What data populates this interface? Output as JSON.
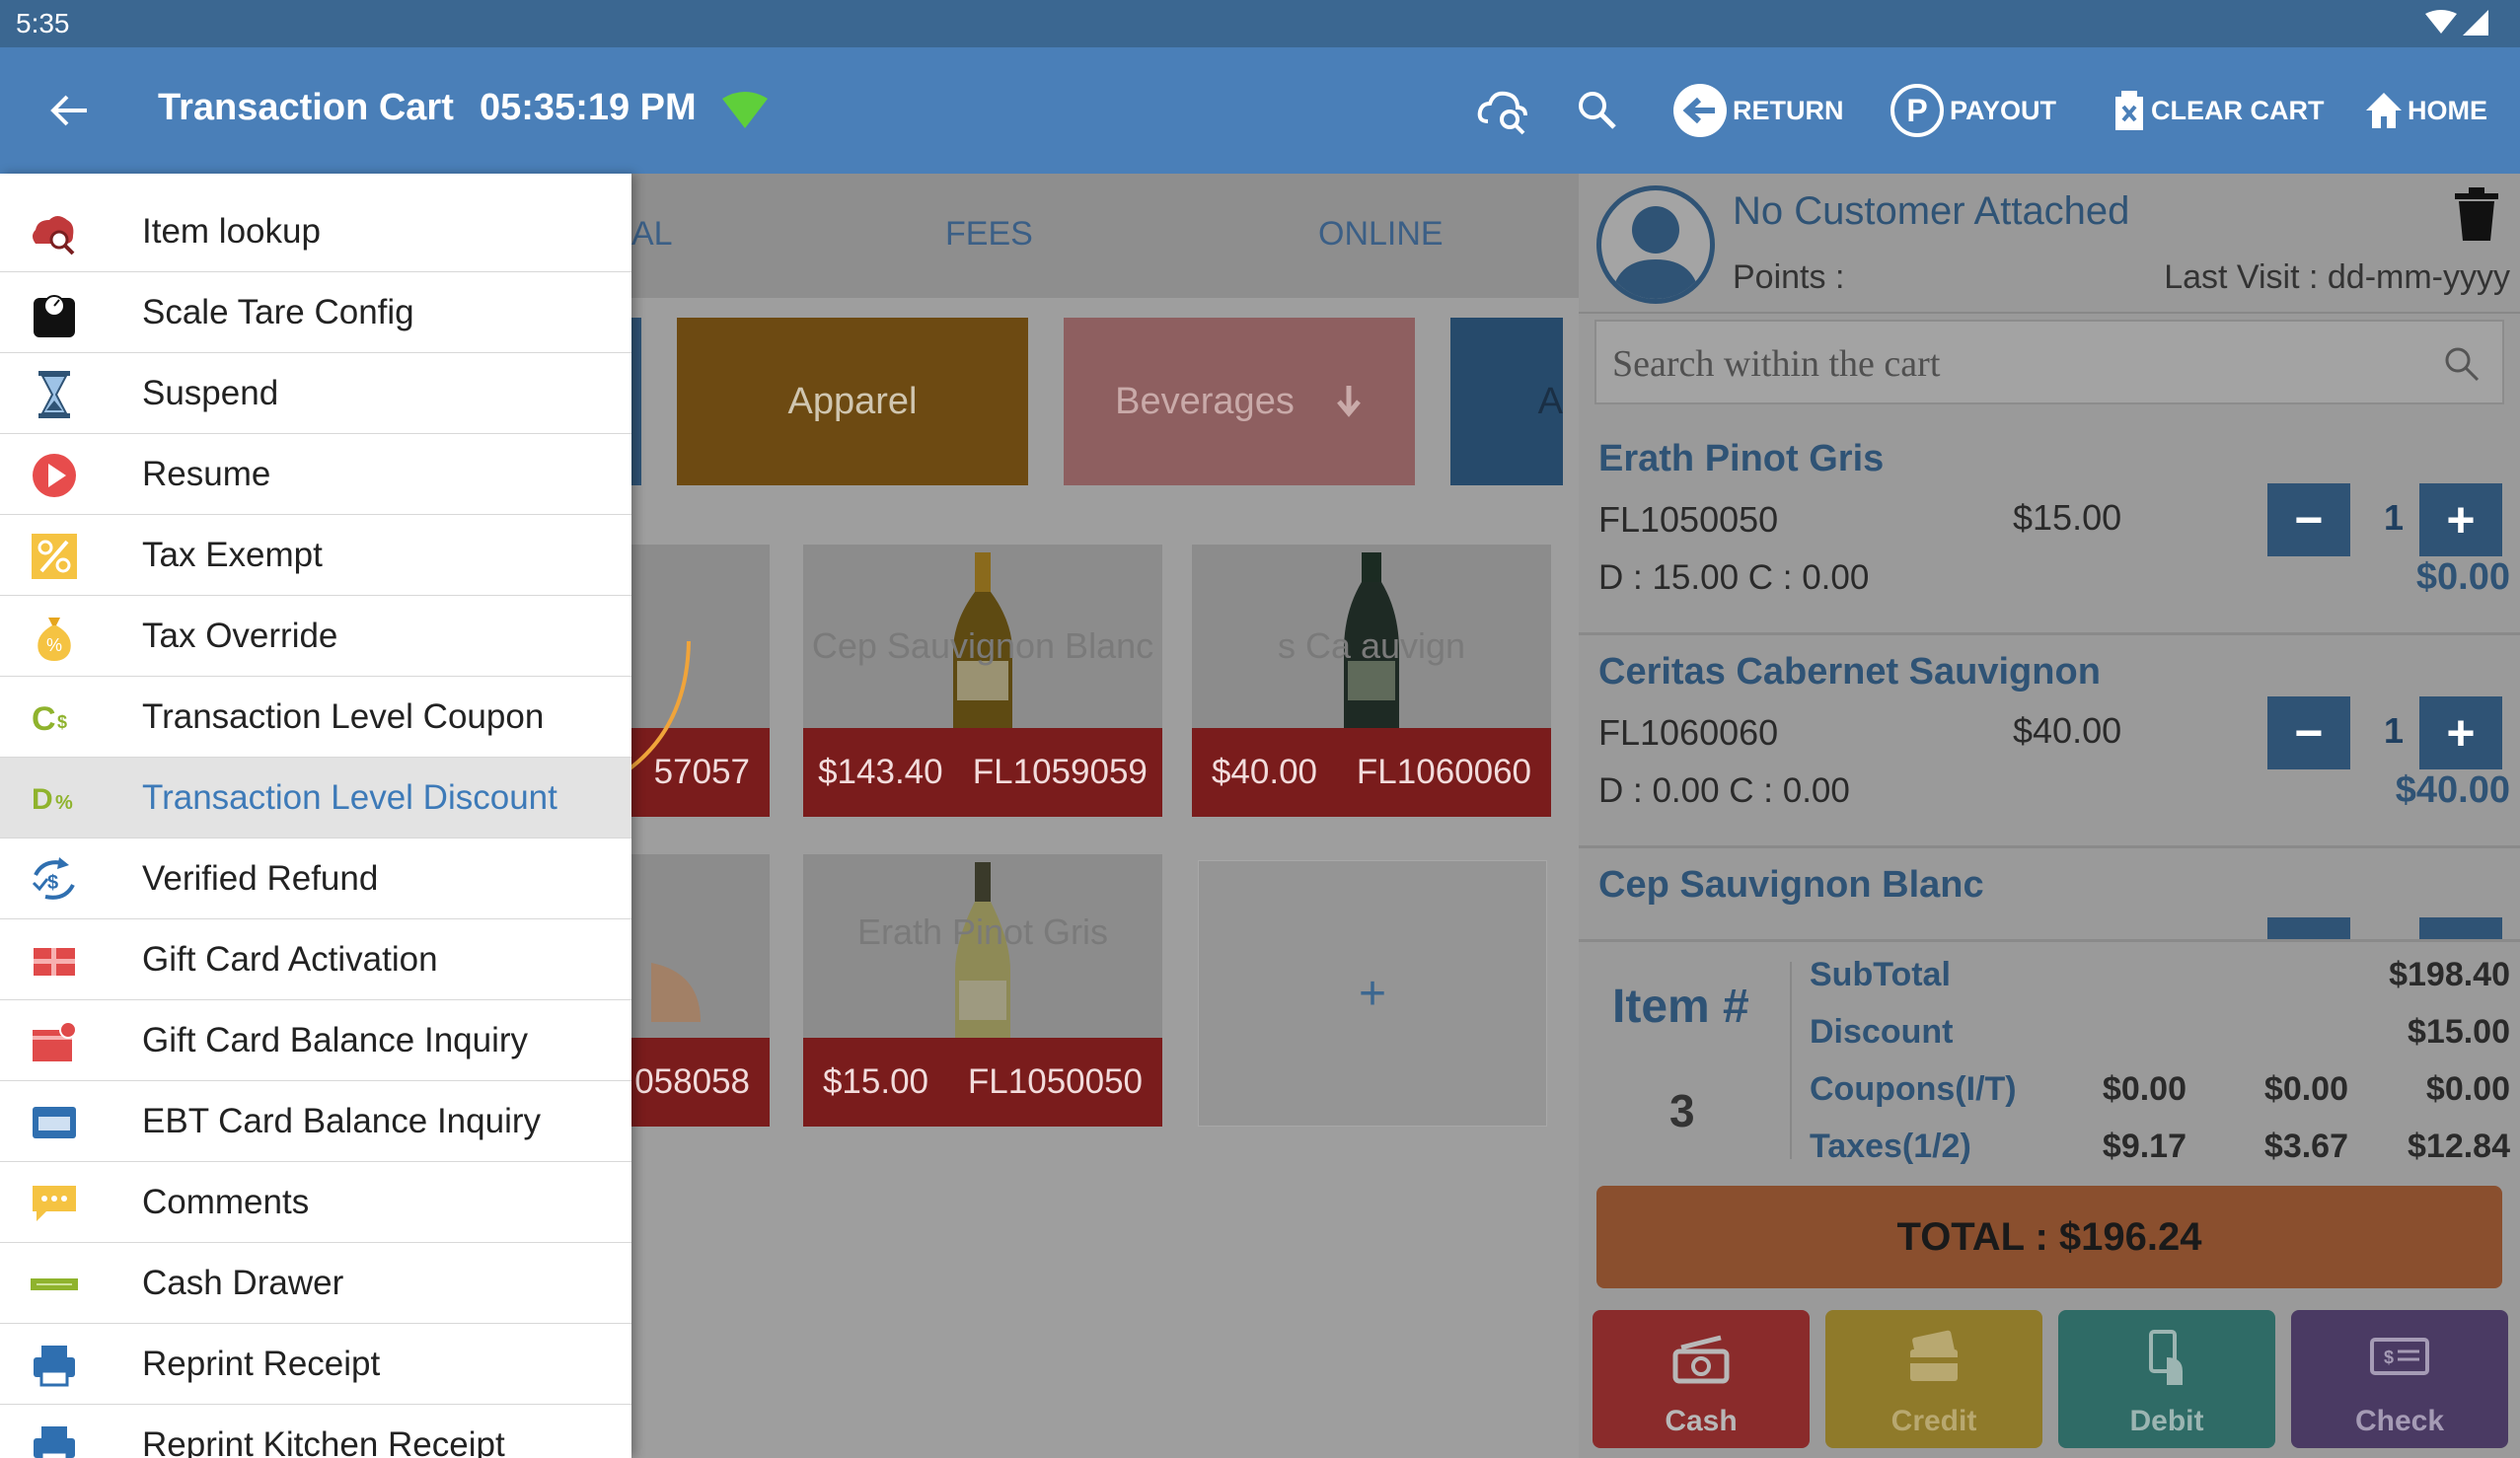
{
  "status": {
    "time": "5:35"
  },
  "appbar": {
    "title": "Transaction Cart",
    "clock": "05:35:19 PM",
    "actions": {
      "return": "RETURN",
      "payout": "PAYOUT",
      "clear_cart": "CLEAR CART",
      "home": "HOME"
    }
  },
  "tabs": [
    "AL",
    "FEES",
    "ONLINE"
  ],
  "categories": [
    "Apparel",
    "Beverages",
    "A"
  ],
  "products": [
    {
      "label": "",
      "price": "",
      "sku": "57057"
    },
    {
      "label": "Cep Sauvignon Blanc",
      "price": "$143.40",
      "sku": "FL1059059"
    },
    {
      "label": "s Ca auvign",
      "price": "$40.00",
      "sku": "FL1060060"
    },
    {
      "label": "",
      "price": "",
      "sku": "058058"
    },
    {
      "label": "Erath Pinot Gris",
      "price": "$15.00",
      "sku": "FL1050050"
    }
  ],
  "add_tile": "+",
  "menu": [
    {
      "label": "Item lookup",
      "icon": "cloud-search-icon"
    },
    {
      "label": "Scale Tare Config",
      "icon": "scale-icon"
    },
    {
      "label": "Suspend",
      "icon": "hourglass-icon"
    },
    {
      "label": "Resume",
      "icon": "play-icon"
    },
    {
      "label": "Tax Exempt",
      "icon": "percent-icon"
    },
    {
      "label": "Tax Override",
      "icon": "money-bag-icon"
    },
    {
      "label": "Transaction Level Coupon",
      "icon": "coupon-icon"
    },
    {
      "label": "Transaction Level Discount",
      "icon": "discount-icon"
    },
    {
      "label": "Verified Refund",
      "icon": "refund-icon"
    },
    {
      "label": "Gift Card Activation",
      "icon": "gift-card-icon"
    },
    {
      "label": "Gift Card Balance Inquiry",
      "icon": "gift-balance-icon"
    },
    {
      "label": "EBT Card Balance Inquiry",
      "icon": "ebt-card-icon"
    },
    {
      "label": "Comments",
      "icon": "comment-icon"
    },
    {
      "label": "Cash Drawer",
      "icon": "cash-drawer-icon"
    },
    {
      "label": "Reprint Receipt",
      "icon": "printer-icon"
    },
    {
      "label": "Reprint Kitchen Receipt",
      "icon": "printer-icon"
    }
  ],
  "customer": {
    "name": "No Customer Attached",
    "points": "Points :",
    "last_visit": "Last Visit : dd-mm-yyyy"
  },
  "cart_search": {
    "placeholder": "Search within the cart"
  },
  "cart_items": [
    {
      "name": "Erath Pinot Gris",
      "sku": "FL1050050",
      "price": "$15.00",
      "dc": "D : 15.00     C : 0.00",
      "qty": "1",
      "total": "$0.00"
    },
    {
      "name": "Ceritas Cabernet Sauvignon",
      "sku": "FL1060060",
      "price": "$40.00",
      "dc": "D : 0.00     C : 0.00",
      "qty": "1",
      "total": "$40.00"
    },
    {
      "name": "Cep Sauvignon Blanc",
      "sku": "",
      "price": "",
      "dc": "",
      "qty": "",
      "total": ""
    }
  ],
  "summary": {
    "item_label": "Item #",
    "item_count": "3",
    "subtotal_label": "SubTotal",
    "subtotal": "$198.40",
    "discount_label": "Discount",
    "discount": "$15.00",
    "coupons_label": "Coupons(I/T)",
    "coupons": [
      "$0.00",
      "$0.00",
      "$0.00"
    ],
    "taxes_label": "Taxes(1/2)",
    "taxes": [
      "$9.17",
      "$3.67",
      "$12.84"
    ],
    "total": "TOTAL : $196.24"
  },
  "tenders": [
    "Cash",
    "Credit",
    "Debit",
    "Check"
  ],
  "colors": {
    "appbar": "#4a7fb8",
    "statusbar": "#3b6791",
    "active_menu_text": "#3d7ab8",
    "cash": "#8a2b2b",
    "credit": "#8f7a2a",
    "debit": "#2f6b66",
    "check": "#4a3a63",
    "total_bar": "#8a4f2e"
  }
}
